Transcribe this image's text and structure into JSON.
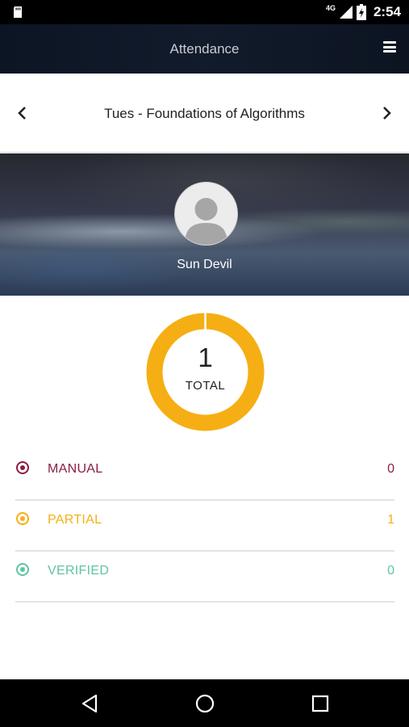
{
  "status_bar": {
    "network": "4G",
    "time": "2:54",
    "icons": [
      "sd-card-icon",
      "signal-icon",
      "battery-icon"
    ]
  },
  "app_bar": {
    "title": "Attendance",
    "menu_icon": "menu-icon"
  },
  "course": {
    "title": "Tues - Foundations of Algorithms",
    "prev_icon": "chevron-left-icon",
    "next_icon": "chevron-right-icon"
  },
  "profile": {
    "name": "Sun Devil",
    "avatar_icon": "avatar-placeholder-icon"
  },
  "summary": {
    "total": "1",
    "total_label": "TOTAL",
    "ring_color": "#F5AF14"
  },
  "stats": [
    {
      "label": "MANUAL",
      "value": "0",
      "color": "#8C1D40",
      "icon": "radio-target-icon"
    },
    {
      "label": "PARTIAL",
      "value": "1",
      "color": "#F5AF14",
      "icon": "radio-target-icon"
    },
    {
      "label": "VERIFIED",
      "value": "0",
      "color": "#5FC3A4",
      "icon": "radio-target-icon"
    }
  ],
  "nav_bar": {
    "icons": [
      "back-icon",
      "home-icon",
      "recents-icon"
    ]
  }
}
